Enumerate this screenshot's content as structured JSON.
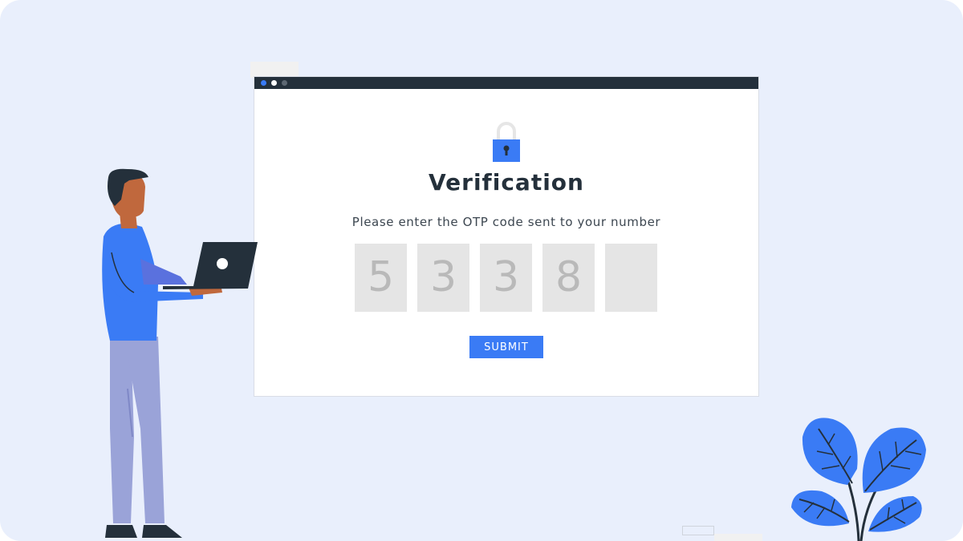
{
  "window": {
    "titlebar_dots": [
      "#3a7bf5",
      "#ffffff",
      "#5d6873"
    ]
  },
  "verification": {
    "title": "Verification",
    "subtitle": "Please enter the OTP code sent to your number",
    "otp_digits": [
      "5",
      "3",
      "3",
      "8",
      ""
    ],
    "submit_label": "SUBMIT"
  },
  "icons": {
    "lock": "padlock-icon"
  },
  "colors": {
    "accent": "#3a7bf5",
    "background": "#e9effc",
    "titlebar": "#24303b",
    "otp_box": "#e5e5e5",
    "otp_digit": "#b9b9b9",
    "text_dark": "#24303b"
  }
}
